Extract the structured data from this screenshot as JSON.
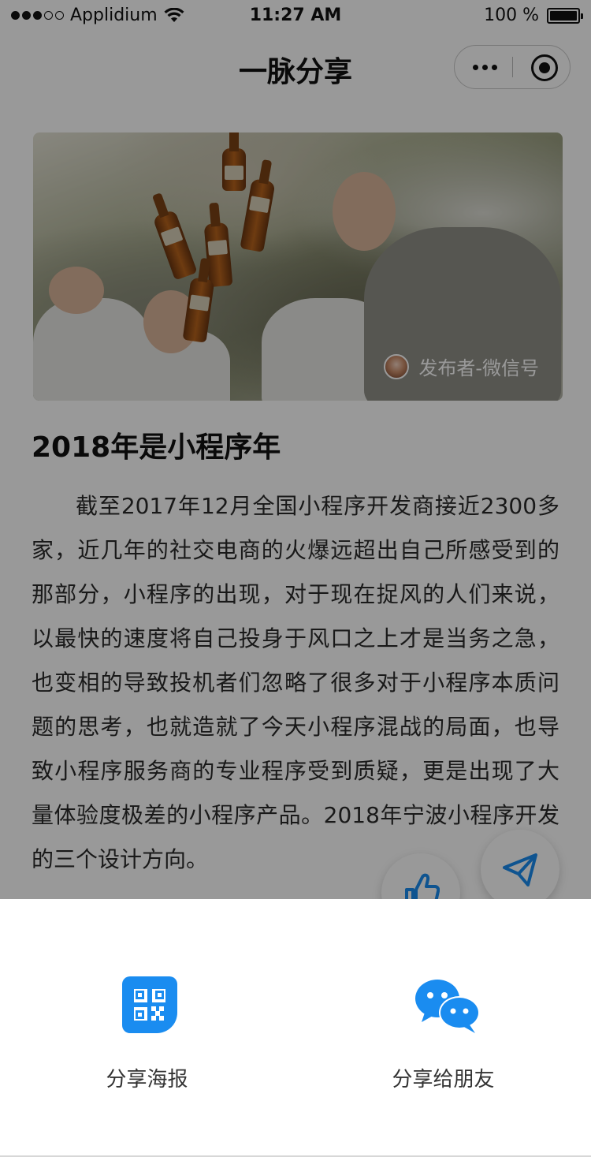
{
  "status_bar": {
    "carrier": "Applidium",
    "time": "11:27 AM",
    "battery": "100 %"
  },
  "nav": {
    "title": "一脉分享"
  },
  "hero": {
    "publisher": "发布者-微信号"
  },
  "article": {
    "title": "2018年是小程序年",
    "body": "截至2017年12月全国小程序开发商接近2300多家，近几年的社交电商的火爆远超出自己所感受到的那部分，小程序的出现，对于现在捉风的人们来说，以最快的速度将自己投身于风口之上才是当务之急，也变相的导致投机者们忽略了很多对于小程序本质问题的思考，也就造就了今天小程序混战的局面，也导致小程序服务商的专业程序受到质疑，更是出现了大量体验度极差的小程序产品。2018年宁波小程序开发的三个设计方向。"
  },
  "share_sheet": {
    "poster_label": "分享海报",
    "friend_label": "分享给朋友"
  },
  "colors": {
    "accent": "#1a8cf0",
    "overlay": "rgba(0,0,0,0.4)"
  },
  "icons": {
    "like": "thumbs-up-icon",
    "share": "paper-plane-icon",
    "poster": "qr-code-icon",
    "friend": "wechat-icon"
  }
}
